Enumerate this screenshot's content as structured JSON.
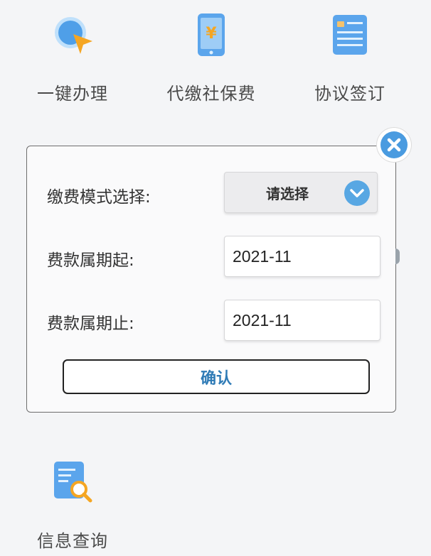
{
  "services": [
    {
      "label": "一键办理",
      "icon": "pointer-click-icon"
    },
    {
      "label": "代缴社保费",
      "icon": "phone-yuan-icon"
    },
    {
      "label": "协议签订",
      "icon": "document-card-icon"
    },
    {
      "label": "信息查询",
      "icon": "document-search-icon"
    }
  ],
  "dialog": {
    "fields": {
      "mode_label": "缴费模式选择:",
      "mode_value": "请选择",
      "start_label": "费款属期起:",
      "start_value": "2021-11",
      "end_label": "费款属期止:",
      "end_value": "2021-11"
    },
    "confirm_label": "确认"
  },
  "colors": {
    "accent": "#4a9be0",
    "confirm_text": "#2f7bb6",
    "icon_blue": "#5ba5ec",
    "icon_orange": "#f5a623"
  }
}
